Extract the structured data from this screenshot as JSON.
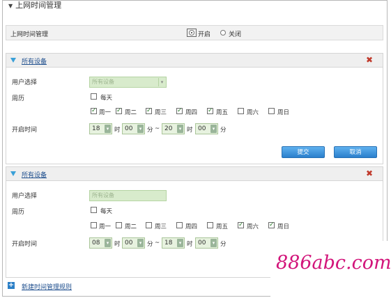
{
  "page": {
    "title": "上网时间管理"
  },
  "master": {
    "label": "上网时间管理",
    "on_label": "开启",
    "off_label": "关闭",
    "selected": "on"
  },
  "labels": {
    "user_select": "用户选择",
    "calendar": "周历",
    "open_time": "开启时间",
    "everyday": "每天",
    "hour": "时",
    "minute": "分",
    "tilde": "~"
  },
  "days": [
    "周一",
    "周二",
    "周三",
    "周四",
    "周五",
    "周六",
    "周日"
  ],
  "rules": [
    {
      "title": "所有设备",
      "device_placeholder": "所有设备",
      "everyday": false,
      "days_checked": [
        true,
        true,
        true,
        true,
        true,
        false,
        false
      ],
      "start_hour": "18",
      "start_min": "00",
      "end_hour": "20",
      "end_min": "00",
      "submit_label": "提交",
      "cancel_label": "取消"
    },
    {
      "title": "所有设备",
      "device_placeholder": "所有设备",
      "everyday": false,
      "days_checked": [
        false,
        false,
        false,
        false,
        false,
        true,
        true
      ],
      "start_hour": "08",
      "start_min": "00",
      "end_hour": "18",
      "end_min": "00"
    }
  ],
  "add_rule_label": "新建时间管理规则",
  "watermark": "886abc.com",
  "colors": {
    "accent_blue": "#2a7fcc",
    "link": "#1f4f8e",
    "delete_red": "#c0392b",
    "select_green": "#d8ebcc",
    "watermark_pink": "#d2147a"
  }
}
